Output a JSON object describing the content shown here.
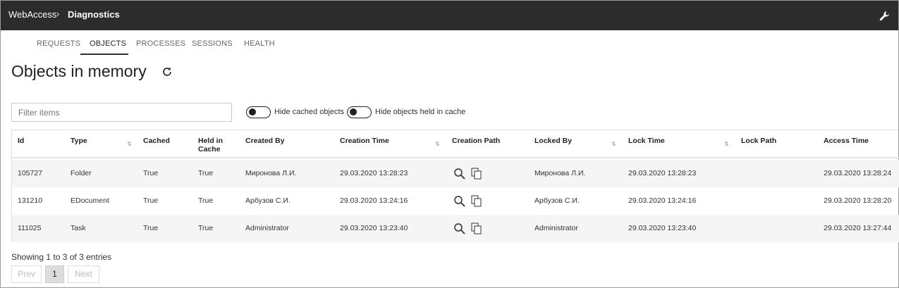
{
  "breadcrumb": {
    "root": "WebAccess",
    "separator": "›",
    "current": "Diagnostics"
  },
  "header_icons": {
    "settings": "wrench-icon"
  },
  "tabs": [
    {
      "label": "REQUESTS",
      "active": false
    },
    {
      "label": "OBJECTS",
      "active": true
    },
    {
      "label": "PROCESSES",
      "active": false
    },
    {
      "label": "SESSIONS",
      "active": false
    },
    {
      "label": "HEALTH",
      "active": false
    }
  ],
  "page": {
    "title": "Objects in memory",
    "refresh_icon": "refresh-icon"
  },
  "filter": {
    "placeholder": "Filter items",
    "value": ""
  },
  "toggles": [
    {
      "label": "Hide cached objects",
      "on": false
    },
    {
      "label": "Hide objects held in cache",
      "on": false
    }
  ],
  "table": {
    "columns": [
      {
        "label": "Id",
        "sortable": false
      },
      {
        "label": "Type",
        "sortable": true
      },
      {
        "label": "Cached",
        "sortable": false
      },
      {
        "label": "Held in Cache",
        "sortable": false
      },
      {
        "label": "Created By",
        "sortable": false
      },
      {
        "label": "Creation Time",
        "sortable": true
      },
      {
        "label": "Creation Path",
        "sortable": false
      },
      {
        "label": "Locked By",
        "sortable": true
      },
      {
        "label": "Lock Time",
        "sortable": true
      },
      {
        "label": "Lock Path",
        "sortable": false
      },
      {
        "label": "Access Time",
        "sortable": false
      }
    ],
    "rows": [
      {
        "id": "105727",
        "type": "Folder",
        "cached": "True",
        "held": "True",
        "created_by": "Миронова Л.И.",
        "creation_time": "29.03.2020 13:28:23",
        "locked_by": "Миронова Л.И.",
        "lock_time": "29.03.2020 13:28:23",
        "lock_path": "",
        "access_time": "29.03.2020 13:28:24"
      },
      {
        "id": "131210",
        "type": "EDocument",
        "cached": "True",
        "held": "True",
        "created_by": "Арбузов С.И.",
        "creation_time": "29.03.2020 13:24:16",
        "locked_by": "Арбузов С.И.",
        "lock_time": "29.03.2020 13:24:16",
        "lock_path": "",
        "access_time": "29.03.2020 13:28:20"
      },
      {
        "id": "111025",
        "type": "Task",
        "cached": "True",
        "held": "True",
        "created_by": "Administrator",
        "creation_time": "29.03.2020 13:23:40",
        "locked_by": "Administrator",
        "lock_time": "29.03.2020 13:23:40",
        "lock_path": "",
        "access_time": "29.03.2020 13:27:44"
      }
    ],
    "row_icons": [
      "search-icon",
      "copy-icon"
    ]
  },
  "footer": {
    "info": "Showing 1 to 3 of 3 entries",
    "prev": "Prev",
    "page": "1",
    "next": "Next"
  }
}
